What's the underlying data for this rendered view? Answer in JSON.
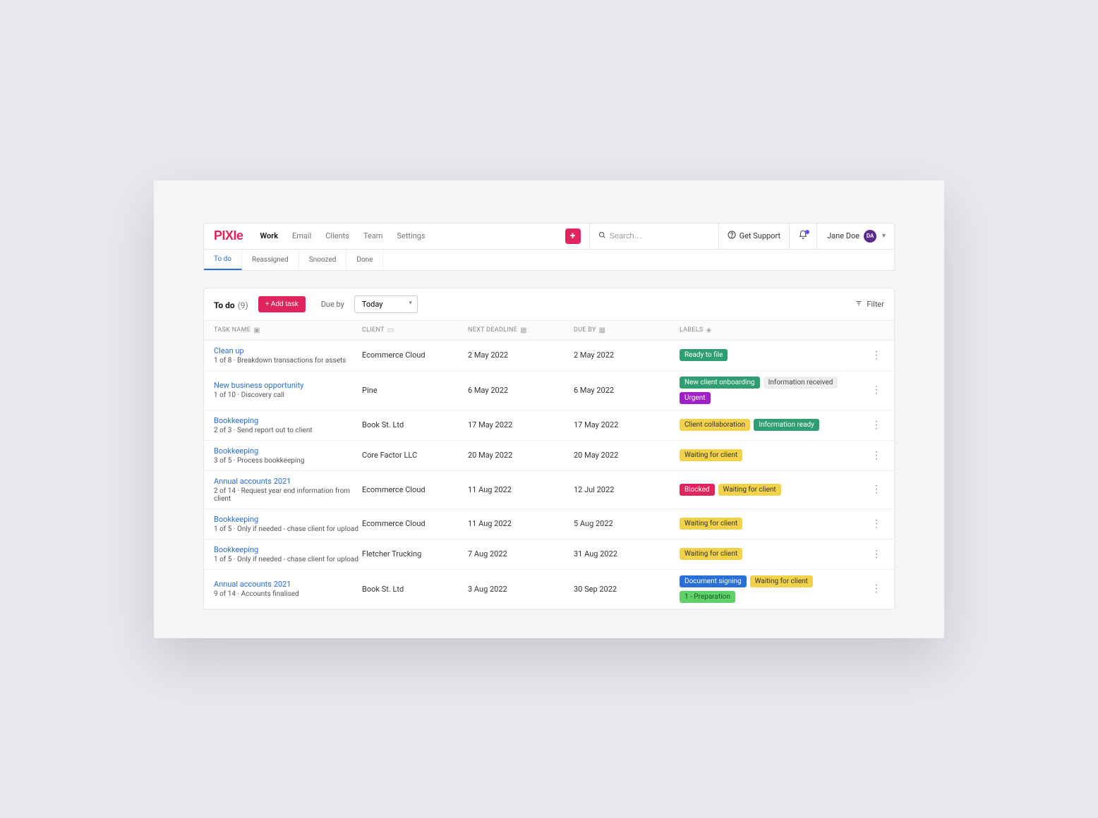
{
  "brand": "PIXIe",
  "nav": {
    "items": [
      "Work",
      "Email",
      "Clients",
      "Team",
      "Settings"
    ],
    "active": "Work"
  },
  "search": {
    "placeholder": "Search…"
  },
  "support": {
    "label": "Get Support"
  },
  "user": {
    "name": "Jane Doe",
    "initials": "DA"
  },
  "subtabs": {
    "items": [
      "To do",
      "Reassigned",
      "Snoozed",
      "Done"
    ],
    "active": "To do"
  },
  "toolbar": {
    "section_label": "To do",
    "count_display": "(9)",
    "add_task_label": "+ Add task",
    "dueby_label": "Due by",
    "dueby_value": "Today",
    "filter_label": "Filter"
  },
  "columns": {
    "task": "Task Name",
    "client": "Client",
    "deadline": "Next Deadline",
    "due": "Due By",
    "labels": "Labels"
  },
  "label_colors": {
    "Ready to file": {
      "bg": "#2f9e72",
      "fg": "#fff"
    },
    "New client onboarding": {
      "bg": "#2f9e72",
      "fg": "#fff"
    },
    "Information received": {
      "bg": "#eeeeee",
      "fg": "#444"
    },
    "Urgent": {
      "bg": "#a020c7",
      "fg": "#fff"
    },
    "Client collaboration": {
      "bg": "#f3d24b",
      "fg": "#333"
    },
    "Information ready": {
      "bg": "#2f9e72",
      "fg": "#fff"
    },
    "Waiting for client": {
      "bg": "#f3d24b",
      "fg": "#333"
    },
    "Blocked": {
      "bg": "#e0245e",
      "fg": "#fff"
    },
    "Document signing": {
      "bg": "#2a6ed8",
      "fg": "#fff"
    },
    "1 - Preparation": {
      "bg": "#5fd06a",
      "fg": "#145c1a"
    }
  },
  "tasks": [
    {
      "name": "Clean up",
      "meta": "1 of 8 · Breakdown transactions for assets",
      "client": "Ecommerce Cloud",
      "deadline": "2 May 2022",
      "due": "2 May 2022",
      "labels": [
        "Ready to file"
      ]
    },
    {
      "name": "New business opportunity",
      "meta": "1 of 10 · Discovery call",
      "client": "Pine",
      "deadline": "6 May 2022",
      "due": "6 May 2022",
      "labels": [
        "New client onboarding",
        "Information received",
        "Urgent"
      ]
    },
    {
      "name": "Bookkeeping",
      "meta": "2 of 3 · Send report out to client",
      "client": "Book St. Ltd",
      "deadline": "17 May 2022",
      "due": "17 May 2022",
      "labels": [
        "Client collaboration",
        "Information ready"
      ]
    },
    {
      "name": "Bookkeeping",
      "meta": "3 of 5 · Process bookkeeping",
      "client": "Core Factor LLC",
      "deadline": "20 May 2022",
      "due": "20 May 2022",
      "labels": [
        "Waiting for client"
      ]
    },
    {
      "name": "Annual accounts 2021",
      "meta": "2 of 14 · Request year end information from client",
      "client": "Ecommerce Cloud",
      "deadline": "11 Aug 2022",
      "due": "12 Jul 2022",
      "labels": [
        "Blocked",
        "Waiting for client"
      ]
    },
    {
      "name": "Bookkeeping",
      "meta": "1 of 5 · Only if needed - chase client for upload",
      "client": "Ecommerce Cloud",
      "deadline": "11 Aug 2022",
      "due": "5 Aug 2022",
      "labels": [
        "Waiting for client"
      ]
    },
    {
      "name": "Bookkeeping",
      "meta": "1 of 5 · Only if needed - chase client for upload",
      "client": "Fletcher Trucking",
      "deadline": "7 Aug 2022",
      "due": "31 Aug 2022",
      "labels": [
        "Waiting for client"
      ]
    },
    {
      "name": "Annual accounts 2021",
      "meta": "9 of 14 · Accounts finalised",
      "client": "Book St. Ltd",
      "deadline": "3 Aug 2022",
      "due": "30 Sep 2022",
      "labels": [
        "Document signing",
        "Waiting for client",
        "1 - Preparation"
      ]
    }
  ]
}
